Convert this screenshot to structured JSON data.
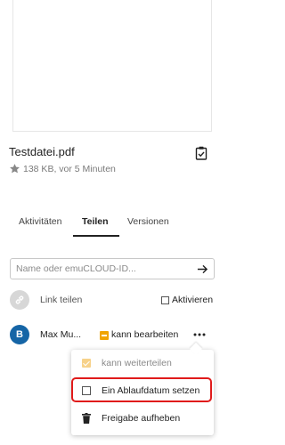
{
  "file": {
    "name": "Testdatei.pdf",
    "meta": "138 KB, vor 5 Minuten",
    "starred": false
  },
  "tabs": [
    {
      "label": "Aktivitäten",
      "active": false
    },
    {
      "label": "Teilen",
      "active": true
    },
    {
      "label": "Versionen",
      "active": false
    }
  ],
  "share_search": {
    "placeholder": "Name oder emuCLOUD-ID...",
    "value": ""
  },
  "link_share": {
    "label": "Link teilen",
    "activate_label": "Aktivieren",
    "activated": false
  },
  "share_user": {
    "avatar_letter": "B",
    "name": "Max Mu...",
    "permission_label": "kann bearbeiten",
    "can_edit": true
  },
  "share_menu": {
    "items": [
      {
        "label": "kann weiterteilen",
        "checked": true,
        "disabled": true
      },
      {
        "label": "Ein Ablaufdatum setzen",
        "checked": false,
        "highlighted": true
      },
      {
        "label": "Freigabe aufheben",
        "icon": "trash-icon"
      }
    ]
  },
  "colors": {
    "accent": "#f0a400",
    "avatar": "#1565a6",
    "highlight": "#e01b1b"
  }
}
